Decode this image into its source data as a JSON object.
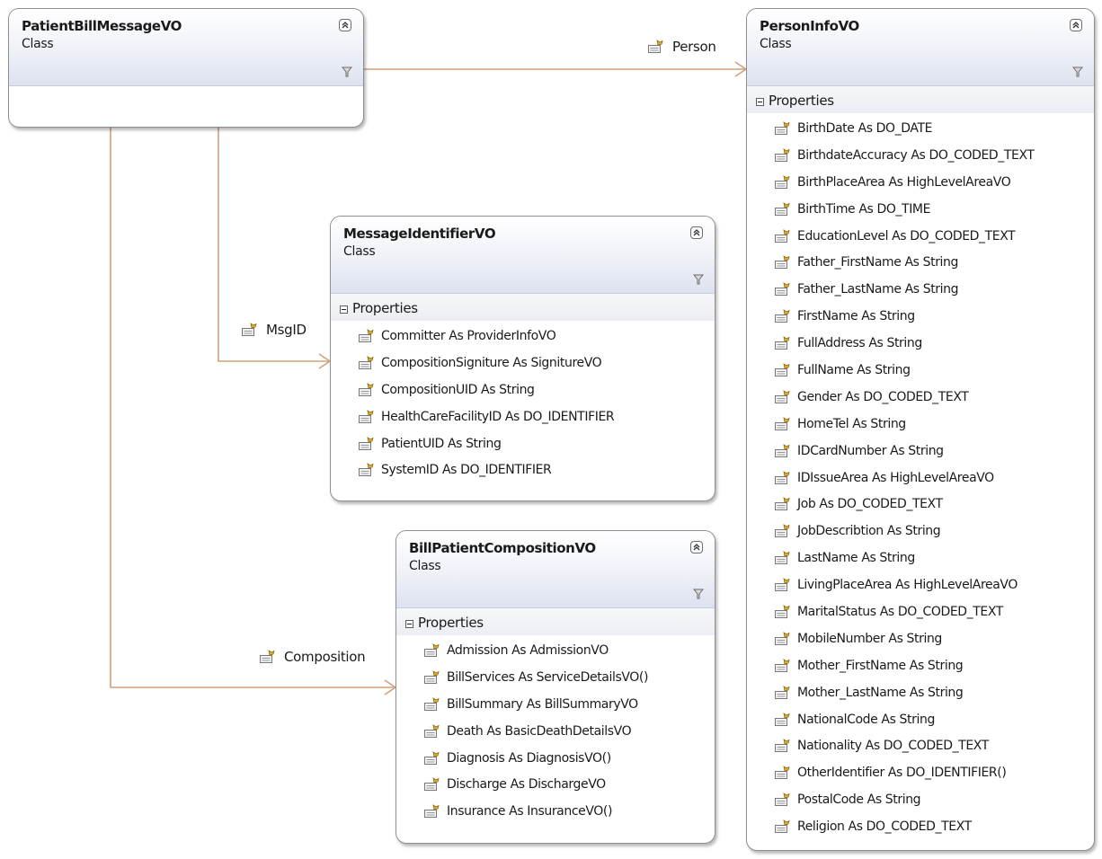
{
  "classes": {
    "patient_bill_message": {
      "name": "PatientBillMessageVO",
      "kind": "Class"
    },
    "message_identifier": {
      "name": "MessageIdentifierVO",
      "kind": "Class",
      "compartment": "Properties",
      "properties": [
        "Committer As ProviderInfoVO",
        "CompositionSigniture As SignitureVO",
        "CompositionUID As String",
        "HealthCareFacilityID As DO_IDENTIFIER",
        "PatientUID As String",
        "SystemID As DO_IDENTIFIER"
      ]
    },
    "bill_patient_composition": {
      "name": "BillPatientCompositionVO",
      "kind": "Class",
      "compartment": "Properties",
      "properties": [
        "Admission As AdmissionVO",
        "BillServices As ServiceDetailsVO()",
        "BillSummary As BillSummaryVO",
        "Death As BasicDeathDetailsVO",
        "Diagnosis As DiagnosisVO()",
        "Discharge As DischargeVO",
        "Insurance As InsuranceVO()"
      ]
    },
    "person_info": {
      "name": "PersonInfoVO",
      "kind": "Class",
      "compartment": "Properties",
      "properties": [
        "BirthDate As DO_DATE",
        "BirthdateAccuracy As DO_CODED_TEXT",
        "BirthPlaceArea As HighLevelAreaVO",
        "BirthTime As DO_TIME",
        "EducationLevel As DO_CODED_TEXT",
        "Father_FirstName As String",
        "Father_LastName As String",
        "FirstName As String",
        "FullAddress As String",
        "FullName As String",
        "Gender As DO_CODED_TEXT",
        "HomeTel As String",
        "IDCardNumber As String",
        "IDIssueArea As HighLevelAreaVO",
        "Job As DO_CODED_TEXT",
        "JobDescribtion As String",
        "LastName As String",
        "LivingPlaceArea As HighLevelAreaVO",
        "MaritalStatus As DO_CODED_TEXT",
        "MobileNumber As String",
        "Mother_FirstName As String",
        "Mother_LastName As String",
        "NationalCode As String",
        "Nationality As DO_CODED_TEXT",
        "OtherIdentifier As DO_IDENTIFIER()",
        "PostalCode As String",
        "Religion As DO_CODED_TEXT"
      ]
    }
  },
  "associations": {
    "person": "Person",
    "msgid": "MsgID",
    "composition": "Composition"
  },
  "icons": {
    "property": "property-icon",
    "collapse": "collapse-chevron-icon",
    "filter": "filter-icon",
    "compartment_toggle": "minus-box-icon"
  },
  "colors": {
    "connector": "#d2a07a",
    "header_gradient_end": "#dde2ef",
    "border": "#8f8f8f"
  }
}
